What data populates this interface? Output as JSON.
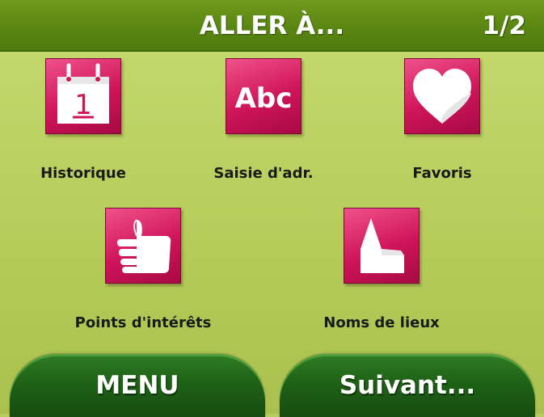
{
  "header": {
    "title": "ALLER À...",
    "page_indicator": "1/2"
  },
  "tiles": [
    {
      "label": "Historique",
      "icon": "calendar-icon",
      "calendar_day": "1"
    },
    {
      "label": "Saisie d'adr.",
      "icon": "abc-text-icon",
      "icon_text": "Abc"
    },
    {
      "label": "Favoris",
      "icon": "heart-icon"
    },
    {
      "label": "Points d'intérêts",
      "icon": "thumbs-up-icon"
    },
    {
      "label": "Noms de lieux",
      "icon": "house-icon"
    }
  ],
  "softkeys": {
    "left_label": "MENU",
    "right_label": "Suivant..."
  },
  "colors": {
    "header_green": "#5a8612",
    "background_green": "#b6cc5c",
    "tile_magenta": "#cf1459",
    "softkey_green": "#1f6217"
  }
}
